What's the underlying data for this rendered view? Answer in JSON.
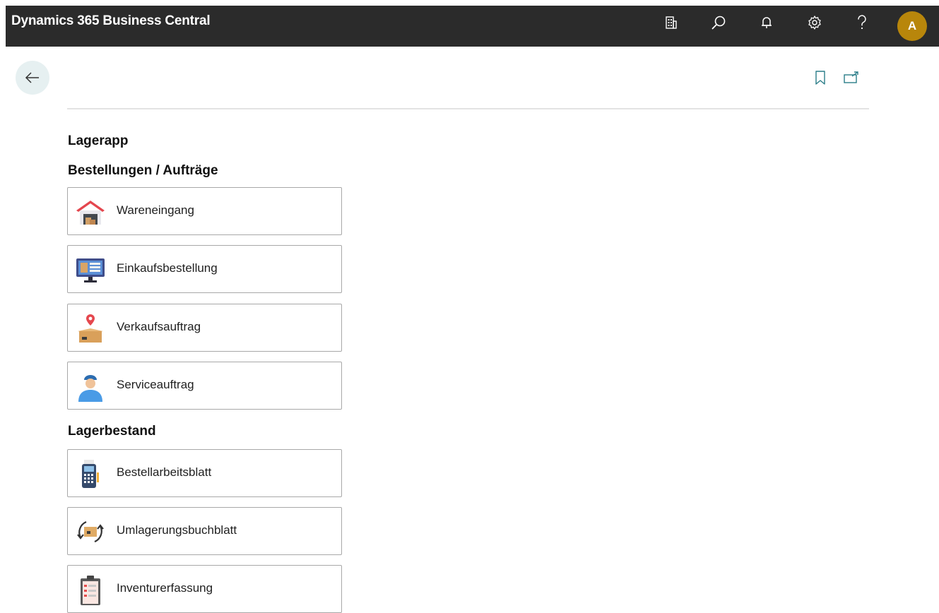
{
  "app": {
    "title": "Dynamics 365 Business Central",
    "avatar_initial": "A",
    "accent": "#b8860b"
  },
  "topbar_icons": [
    "company-icon",
    "search-icon",
    "bell-icon",
    "gear-icon",
    "help-icon"
  ],
  "page": {
    "title": "Lagerapp",
    "groups": [
      {
        "title": "Bestellungen / Aufträge",
        "tiles": [
          {
            "label": "Wareneingang",
            "icon": "warehouse-icon"
          },
          {
            "label": "Einkaufsbestellung",
            "icon": "monitor-icon"
          },
          {
            "label": "Verkaufsauftrag",
            "icon": "box-pin-icon"
          },
          {
            "label": "Serviceauftrag",
            "icon": "worker-icon"
          }
        ]
      },
      {
        "title": "Lagerbestand",
        "tiles": [
          {
            "label": "Bestellarbeitsblatt",
            "icon": "scanner-icon"
          },
          {
            "label": "Umlagerungsbuchblatt",
            "icon": "transfer-icon"
          },
          {
            "label": "Inventurerfassung",
            "icon": "clipboard-icon"
          }
        ]
      }
    ]
  }
}
